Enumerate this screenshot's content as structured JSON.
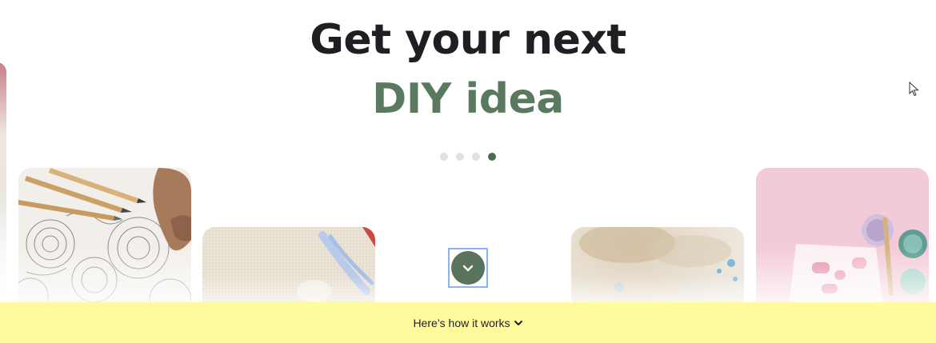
{
  "hero": {
    "headline": "Get your next",
    "subheadline": "DIY idea",
    "subheadline_color": "#5a7a5f",
    "carousel": {
      "pages": 4,
      "active_index": 3
    }
  },
  "cards": [
    {
      "image": "mandala-coloring-with-pencils"
    },
    {
      "image": "embroidery-hoop-with-thread"
    },
    {
      "image": "watercolor-splatter-texture"
    },
    {
      "image": "paint-pots-on-pink-paper"
    }
  ],
  "scroll_button": {
    "icon": "chevron-down-icon",
    "color": "#5a735d"
  },
  "footer": {
    "link_label": "Here’s how it works",
    "background": "#fffb9c",
    "icon": "chevron-down-icon"
  }
}
